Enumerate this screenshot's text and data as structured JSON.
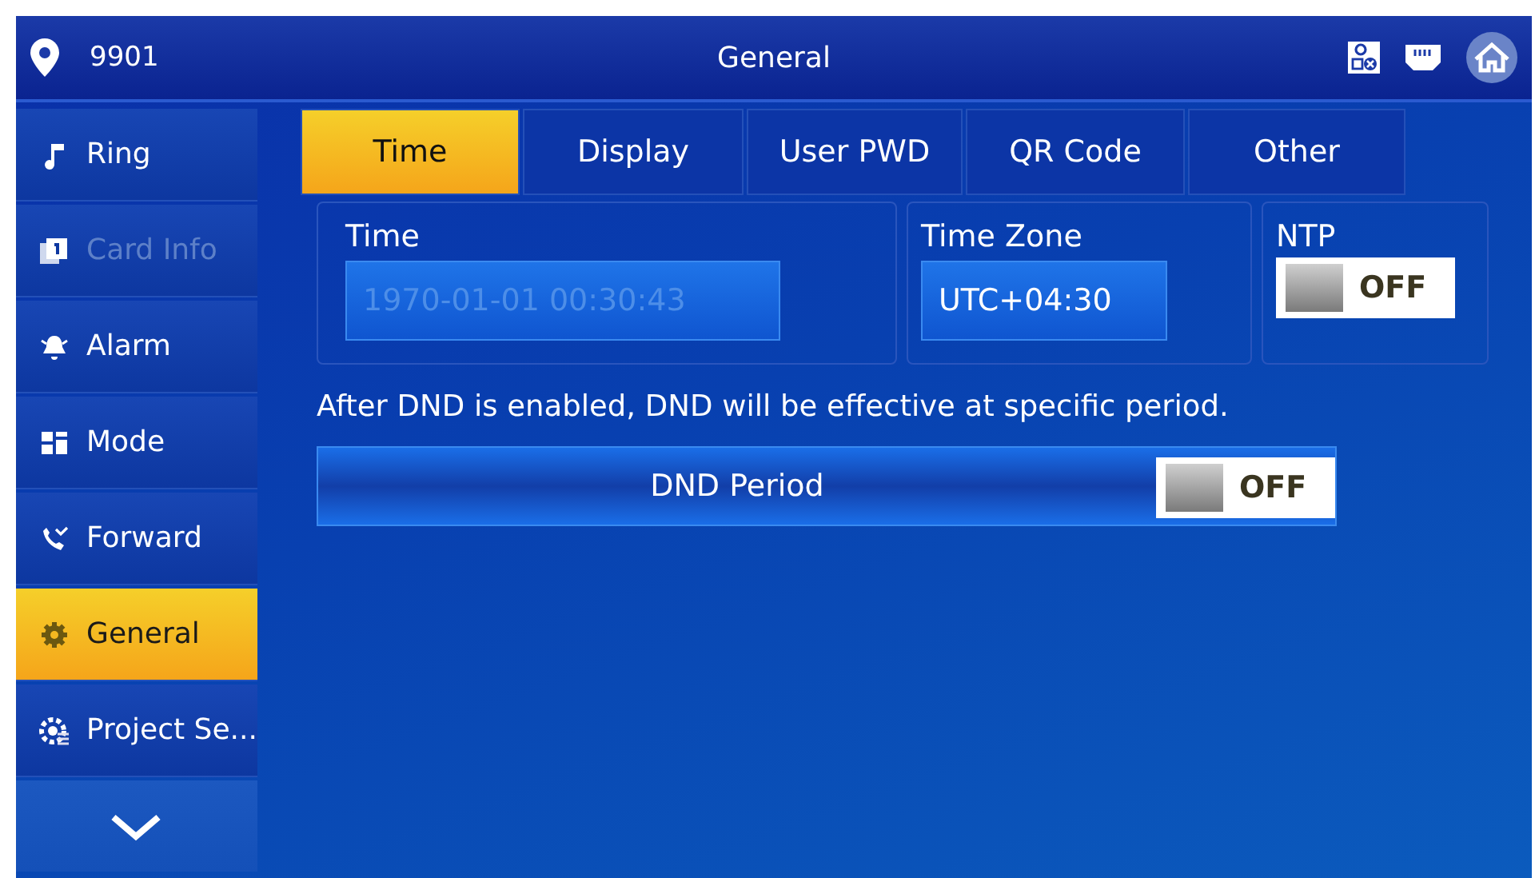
{
  "header": {
    "room": "9901",
    "title": "General"
  },
  "sidebar": {
    "items": [
      {
        "label": "Ring",
        "selected": false,
        "disabled": false
      },
      {
        "label": "Card Info",
        "selected": false,
        "disabled": true
      },
      {
        "label": "Alarm",
        "selected": false,
        "disabled": false
      },
      {
        "label": "Mode",
        "selected": false,
        "disabled": false
      },
      {
        "label": "Forward",
        "selected": false,
        "disabled": false
      },
      {
        "label": "General",
        "selected": true,
        "disabled": false
      },
      {
        "label": "Project Se...",
        "selected": false,
        "disabled": false
      }
    ]
  },
  "tabs": [
    {
      "label": "Time",
      "selected": true
    },
    {
      "label": "Display",
      "selected": false
    },
    {
      "label": "User PWD",
      "selected": false
    },
    {
      "label": "QR Code",
      "selected": false
    },
    {
      "label": "Other",
      "selected": false
    }
  ],
  "time": {
    "label": "Time",
    "value": "1970-01-01 00:30:43",
    "disabled": true
  },
  "time_zone": {
    "label": "Time Zone",
    "value": "UTC+04:30"
  },
  "ntp": {
    "label": "NTP",
    "on": false,
    "state_text": "OFF"
  },
  "note": "After DND is enabled, DND will be effective at specific period.",
  "dnd": {
    "label": "DND Period",
    "on": false,
    "state_text": "OFF"
  }
}
